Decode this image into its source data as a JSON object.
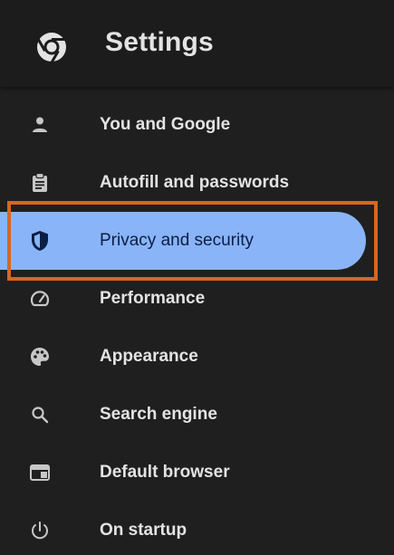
{
  "header": {
    "title": "Settings",
    "logo_icon": "chrome-logo-icon"
  },
  "sidebar": {
    "active_color": "#8ab4f8",
    "highlight_color": "#d9661f",
    "items": [
      {
        "label": "You and Google",
        "icon": "person-icon"
      },
      {
        "label": "Autofill and passwords",
        "icon": "clipboard-icon"
      },
      {
        "label": "Privacy and security",
        "icon": "shield-icon",
        "active": true
      },
      {
        "label": "Performance",
        "icon": "speedometer-icon"
      },
      {
        "label": "Appearance",
        "icon": "palette-icon"
      },
      {
        "label": "Search engine",
        "icon": "search-icon"
      },
      {
        "label": "Default browser",
        "icon": "browser-window-icon"
      },
      {
        "label": "On startup",
        "icon": "power-icon"
      }
    ]
  }
}
